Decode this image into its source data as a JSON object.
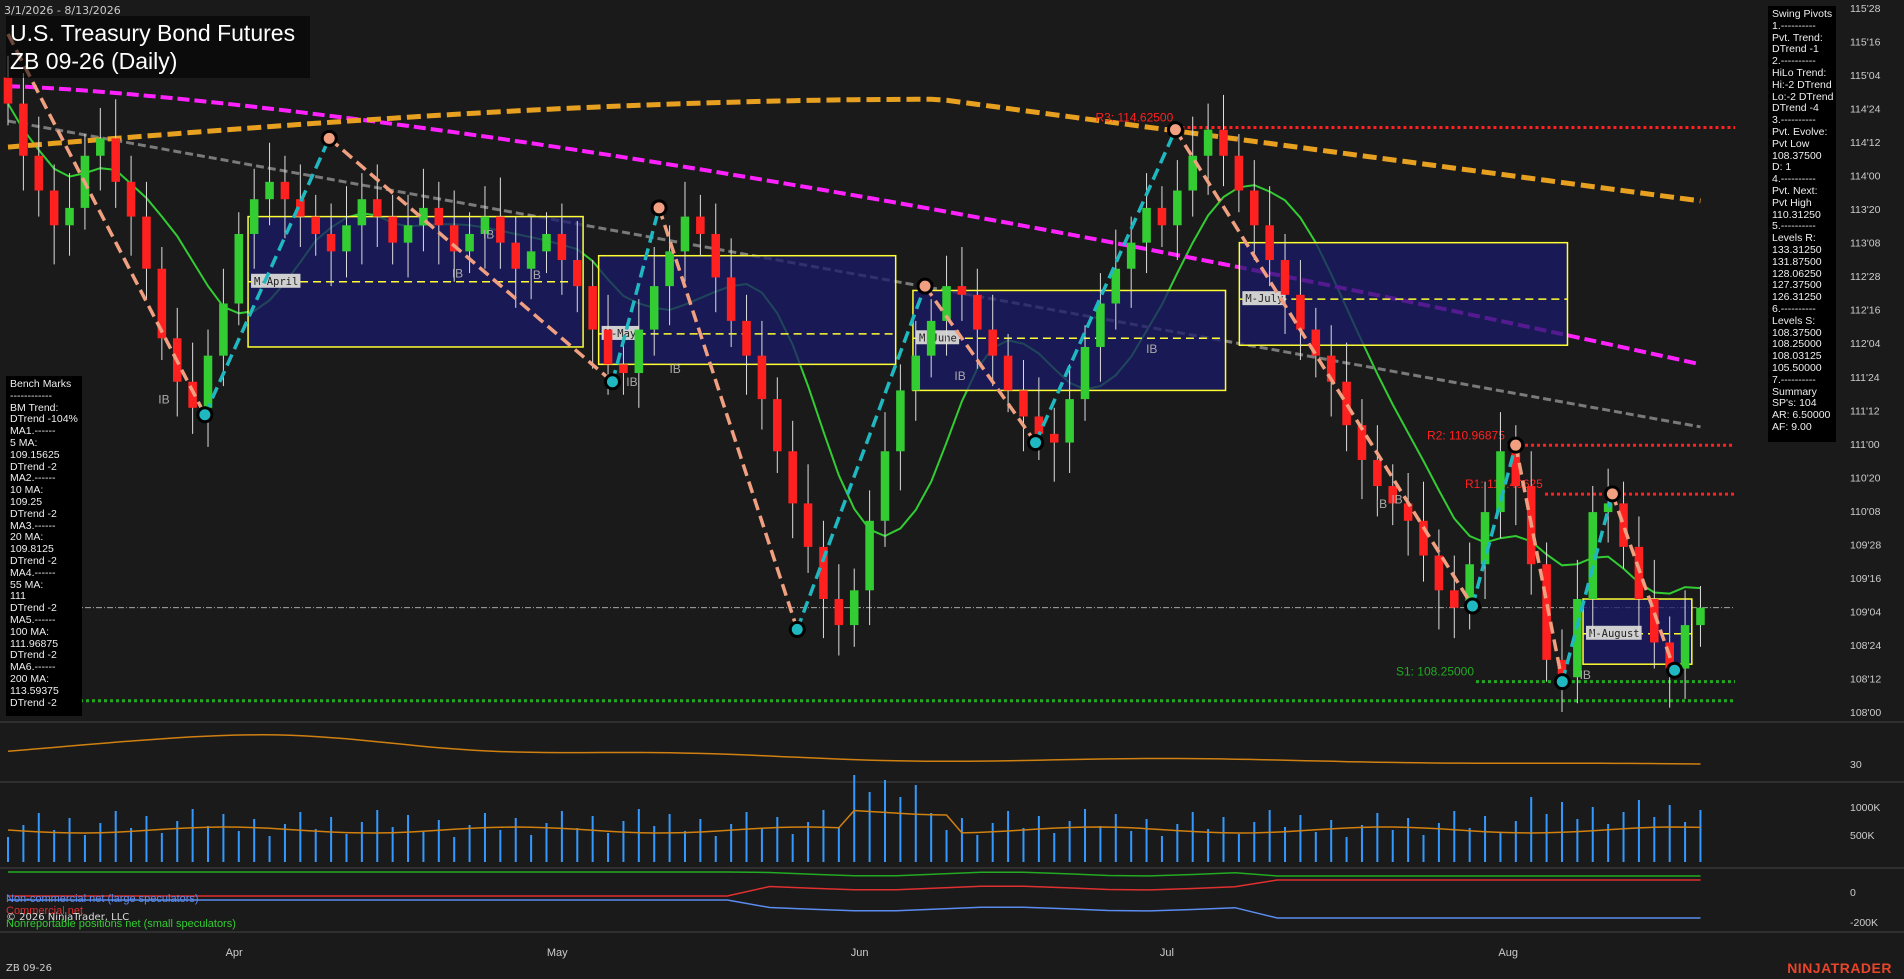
{
  "header": {
    "date_range": "3/1/2026 - 8/13/2026",
    "title": "U.S. Treasury Bond Futures",
    "subtitle": "ZB 09-26 (Daily)"
  },
  "footer": {
    "instrument": "ZB 09-26",
    "brand": "NINJATRADER",
    "copyright": "© 2026 NinjaTrader, LLC"
  },
  "bench_marks": [
    "Bench Marks",
    "------------",
    "BM Trend:",
    "DTrend -104%",
    "MA1.------",
    "5 MA:",
    "109.15625",
    "DTrend -2",
    "MA2.------",
    "10 MA:",
    "109.25",
    "DTrend -2",
    "MA3.------",
    "20 MA:",
    "109.8125",
    "DTrend -2",
    "MA4.------",
    "55 MA:",
    "111",
    "DTrend -2",
    "MA5.------",
    "100 MA:",
    "111.96875",
    "DTrend -2",
    "MA6.------",
    "200 MA:",
    "113.59375",
    "DTrend -2"
  ],
  "swing_pivots": [
    "Swing Pivots",
    "1.----------",
    "Pvt. Trend:",
    "DTrend -1",
    "2.----------",
    "HiLo Trend:",
    "Hi:-2 DTrend",
    "Lo:-2 DTrend",
    "DTrend -4",
    "3.----------",
    "Pvt. Evolve:",
    "Pvt Low",
    "108.37500",
    "D: 1",
    "4.----------",
    "Pvt. Next:",
    "Pvt High",
    "110.31250",
    "5.----------",
    "Levels R:",
    "133.31250",
    "131.87500",
    "128.06250",
    "127.37500",
    "126.31250",
    "6.----------",
    "Levels S:",
    "108.37500",
    "108.25000",
    "108.03125",
    "105.50000",
    "7.----------",
    "Summary",
    "SP's: 104",
    "AR: 6.50000",
    "AF: 9.00"
  ],
  "legend": {
    "noncommercial": "Non-commercial net (large speculators)",
    "commercial": "Commercial net",
    "nonreportable": "Nonreportable positions net (small speculators)"
  },
  "colors": {
    "background": "#1a1a1a",
    "up_candle": "#33cc33",
    "down_candle": "#ff2020",
    "ma_green": "#33cc33",
    "ma_gray": "#7a7a7a",
    "ma_magenta": "#ff22ff",
    "ma_orange": "#e8a020",
    "swing_up": "#20b8c0",
    "swing_down": "#f0a080",
    "resistance": "#ff2020",
    "support": "#22aa22",
    "range_box": "#ffff33",
    "range_fill": "#1a1a6a",
    "volume": "#3399ff",
    "osc": "#d08010"
  },
  "chart_data": {
    "type": "candlestick",
    "x_labels": [
      "Apr",
      "May",
      "Jun",
      "Jul",
      "Aug"
    ],
    "y_tick_labels": [
      "115'28",
      "115'16",
      "115'04",
      "114'24",
      "114'12",
      "114'00",
      "113'20",
      "113'08",
      "112'28",
      "112'16",
      "112'04",
      "111'24",
      "111'12",
      "111'00",
      "110'20",
      "110'08",
      "109'28",
      "109'16",
      "109'04",
      "108'24",
      "108'12",
      "108'00"
    ],
    "ylim": [
      107.9,
      116.0
    ],
    "price_levels": [
      {
        "label": "R3: 114.62500",
        "value": 114.625,
        "start_frac": 0.676,
        "type": "resistance"
      },
      {
        "label": "R2: 110.96875",
        "value": 110.96875,
        "start_frac": 0.868,
        "type": "resistance"
      },
      {
        "label": "R1: 110.40625",
        "value": 110.40625,
        "start_frac": 0.89,
        "type": "resistance"
      },
      {
        "label": "S1: 108.25000",
        "value": 108.25,
        "start_frac": 0.85,
        "type": "support"
      },
      {
        "label": "",
        "value": 108.03,
        "start_frac": 0.0,
        "type": "support"
      }
    ],
    "close_reference": 109.1,
    "monthly_ranges": [
      {
        "label": "M-April",
        "x0": 0.139,
        "x1": 0.333,
        "low": 112.1,
        "high": 113.6,
        "mid": 112.85
      },
      {
        "label": "M-May",
        "x0": 0.342,
        "x1": 0.514,
        "low": 111.9,
        "high": 113.15,
        "mid": 112.25
      },
      {
        "label": "M-June",
        "x0": 0.524,
        "x1": 0.705,
        "low": 111.6,
        "high": 112.75,
        "mid": 112.2
      },
      {
        "label": "M-July",
        "x0": 0.713,
        "x1": 0.903,
        "low": 112.12,
        "high": 113.3,
        "mid": 112.65
      },
      {
        "label": "M-August",
        "x0": 0.912,
        "x1": 0.975,
        "low": 108.45,
        "high": 109.2,
        "mid": 108.8
      }
    ],
    "ib_labels": [
      {
        "x": 0.087,
        "y": 111.45
      },
      {
        "x": 0.257,
        "y": 112.9
      },
      {
        "x": 0.275,
        "y": 113.35
      },
      {
        "x": 0.302,
        "y": 112.88
      },
      {
        "x": 0.358,
        "y": 111.65
      },
      {
        "x": 0.383,
        "y": 111.8
      },
      {
        "x": 0.548,
        "y": 111.72
      },
      {
        "x": 0.659,
        "y": 112.03
      },
      {
        "x": 0.792,
        "y": 110.25
      },
      {
        "x": 0.801,
        "y": 110.3
      },
      {
        "x": 0.91,
        "y": 108.28
      }
    ],
    "swing_points": [
      {
        "x": 0.0,
        "y": 115.7
      },
      {
        "x": 0.114,
        "y": 111.32
      },
      {
        "x": 0.186,
        "y": 114.5
      },
      {
        "x": 0.35,
        "y": 111.7
      },
      {
        "x": 0.377,
        "y": 113.7
      },
      {
        "x": 0.457,
        "y": 108.85
      },
      {
        "x": 0.531,
        "y": 112.8
      },
      {
        "x": 0.595,
        "y": 111.0
      },
      {
        "x": 0.676,
        "y": 114.6
      },
      {
        "x": 0.848,
        "y": 109.12
      },
      {
        "x": 0.873,
        "y": 110.97
      },
      {
        "x": 0.9,
        "y": 108.25
      },
      {
        "x": 0.929,
        "y": 110.41
      },
      {
        "x": 0.965,
        "y": 108.38
      }
    ],
    "closes": [
      114.9,
      114.3,
      113.9,
      113.5,
      113.7,
      114.3,
      114.5,
      114.0,
      113.6,
      113.0,
      112.2,
      111.7,
      111.4,
      112.0,
      112.6,
      113.4,
      113.8,
      114.0,
      113.8,
      113.6,
      113.4,
      113.2,
      113.5,
      113.8,
      113.6,
      113.3,
      113.5,
      113.7,
      113.5,
      113.2,
      113.4,
      113.6,
      113.3,
      113.0,
      113.2,
      113.4,
      113.1,
      112.8,
      112.3,
      111.9,
      111.8,
      112.3,
      112.8,
      113.2,
      113.6,
      113.4,
      112.9,
      112.4,
      112.0,
      111.5,
      110.9,
      110.3,
      109.8,
      109.2,
      108.9,
      109.3,
      110.1,
      110.9,
      111.6,
      112.0,
      112.4,
      112.8,
      112.7,
      112.3,
      112.0,
      111.6,
      111.3,
      111.1,
      111.0,
      111.5,
      112.1,
      112.6,
      113.0,
      113.3,
      113.7,
      113.5,
      113.9,
      114.3,
      114.6,
      114.3,
      113.9,
      113.5,
      113.1,
      112.7,
      112.3,
      112.0,
      111.7,
      111.2,
      110.8,
      110.5,
      110.3,
      110.1,
      109.7,
      109.3,
      109.1,
      109.6,
      110.2,
      110.9,
      110.5,
      109.6,
      108.5,
      108.3,
      109.2,
      110.2,
      110.3,
      109.8,
      109.2,
      108.7,
      108.4,
      108.9,
      109.1
    ]
  }
}
